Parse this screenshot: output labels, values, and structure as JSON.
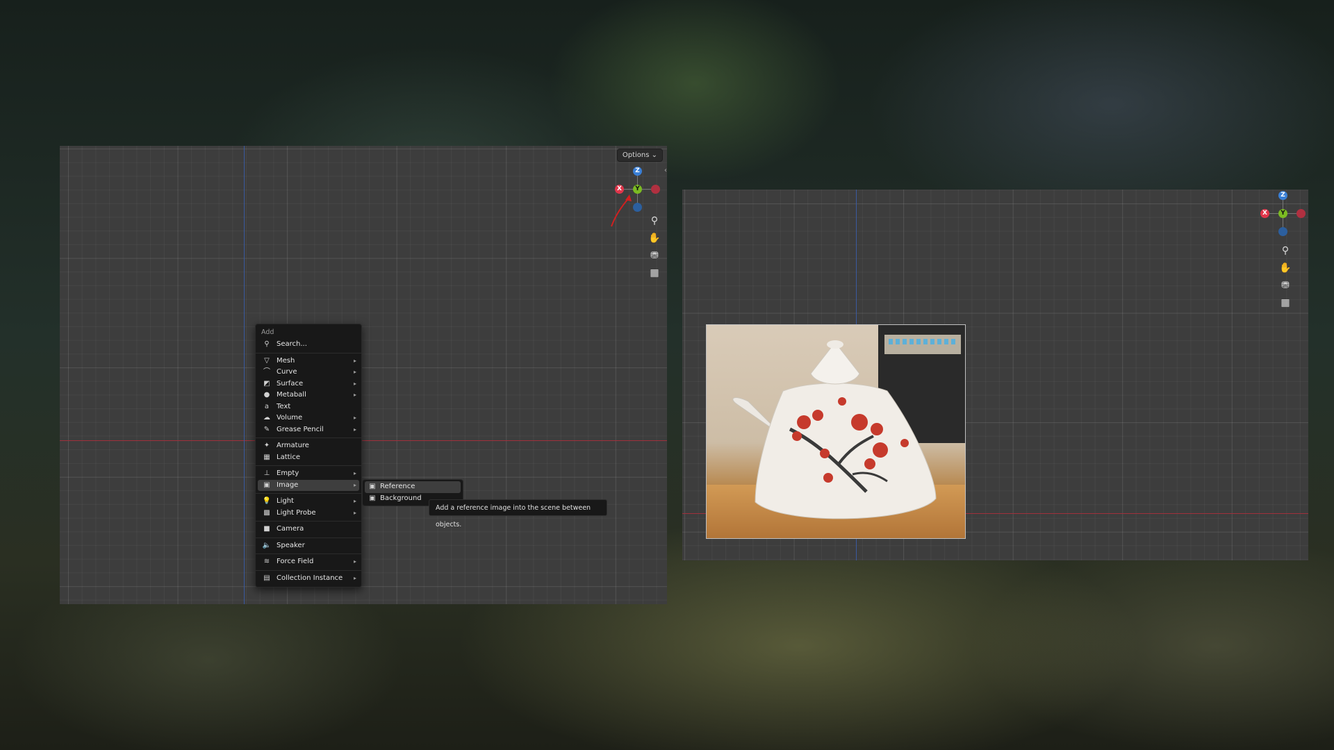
{
  "left_viewport": {
    "options_label": "Options",
    "collapse_glyph": "‹",
    "gizmo": {
      "z": "Z",
      "y": "Y",
      "x": "X"
    },
    "nav_icons": [
      "zoom-icon",
      "hand-icon",
      "camera-icon",
      "grid-icon"
    ]
  },
  "right_viewport": {
    "gizmo": {
      "z": "Z",
      "y": "Y",
      "x": "X"
    },
    "nav_icons": [
      "zoom-icon",
      "hand-icon",
      "camera-icon",
      "grid-icon"
    ]
  },
  "add_menu": {
    "title": "Add",
    "search": "Search...",
    "items": [
      {
        "label": "Mesh",
        "icon": "mesh-icon",
        "glyph": "▽",
        "submenu": true
      },
      {
        "label": "Curve",
        "icon": "curve-icon",
        "glyph": "⌒",
        "submenu": true
      },
      {
        "label": "Surface",
        "icon": "surface-icon",
        "glyph": "◩",
        "submenu": true
      },
      {
        "label": "Metaball",
        "icon": "metaball-icon",
        "glyph": "●",
        "submenu": true
      },
      {
        "label": "Text",
        "icon": "text-icon",
        "glyph": "a",
        "submenu": false
      },
      {
        "label": "Volume",
        "icon": "volume-icon",
        "glyph": "☁",
        "submenu": true
      },
      {
        "label": "Grease Pencil",
        "icon": "grease-pencil-icon",
        "glyph": "✎",
        "submenu": true
      },
      {
        "label": "Armature",
        "icon": "armature-icon",
        "glyph": "✦",
        "submenu": false
      },
      {
        "label": "Lattice",
        "icon": "lattice-icon",
        "glyph": "▦",
        "submenu": false
      },
      {
        "label": "Empty",
        "icon": "empty-icon",
        "glyph": "⊥",
        "submenu": true
      },
      {
        "label": "Image",
        "icon": "image-icon",
        "glyph": "▣",
        "submenu": true
      },
      {
        "label": "Light",
        "icon": "light-icon",
        "glyph": "💡",
        "submenu": true
      },
      {
        "label": "Light Probe",
        "icon": "light-probe-icon",
        "glyph": "▩",
        "submenu": true
      },
      {
        "label": "Camera",
        "icon": "camera-icon",
        "glyph": "■",
        "submenu": false
      },
      {
        "label": "Speaker",
        "icon": "speaker-icon",
        "glyph": "🔈",
        "submenu": false
      },
      {
        "label": "Force Field",
        "icon": "force-field-icon",
        "glyph": "≋",
        "submenu": true
      },
      {
        "label": "Collection Instance",
        "icon": "collection-icon",
        "glyph": "▤",
        "submenu": true
      }
    ]
  },
  "image_submenu": {
    "items": [
      {
        "label": "Reference",
        "icon": "reference-image-icon",
        "glyph": "▣"
      },
      {
        "label": "Background",
        "icon": "background-image-icon",
        "glyph": "▣"
      }
    ]
  },
  "tooltip": {
    "text": "Add a reference image into the scene between objects."
  },
  "colors": {
    "x_axis": "#e0364b",
    "y_axis": "#7bbb22",
    "z_axis": "#3a7fd6",
    "annotation_arrow": "#d02020"
  }
}
